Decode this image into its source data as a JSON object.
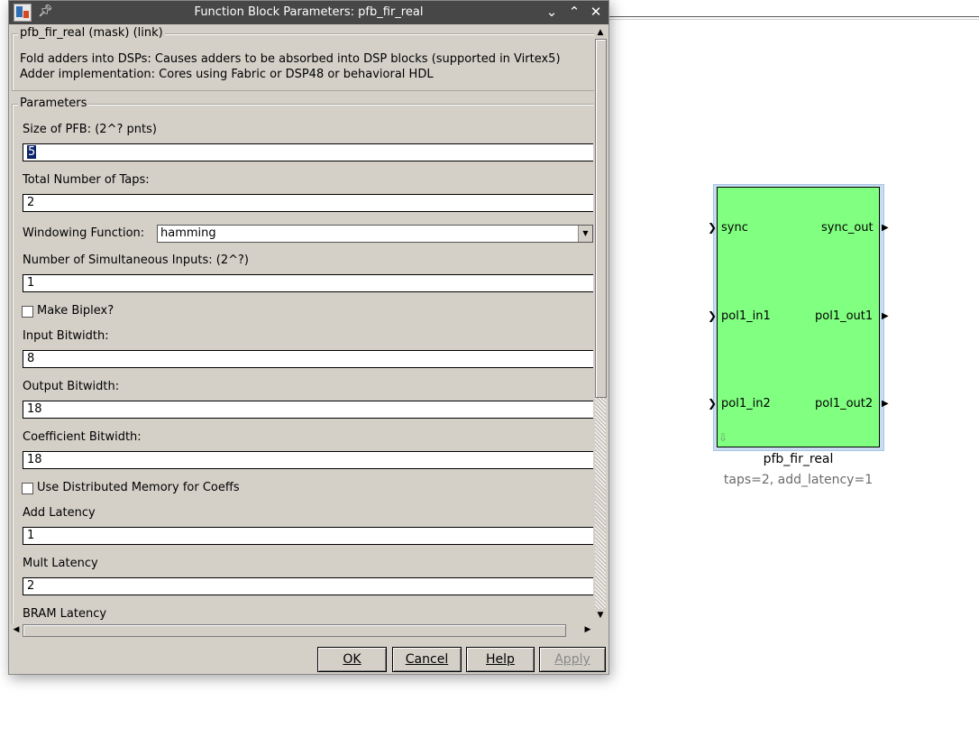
{
  "window": {
    "title": "Function Block Parameters: pfb_fir_real",
    "pin_icon": "pin-icon",
    "minimize_icon": "chevron-down-icon",
    "maximize_icon": "chevron-up-icon",
    "close_icon": "close-icon"
  },
  "mask": {
    "header": "pfb_fir_real (mask) (link)",
    "description_line1": "Fold adders into DSPs: Causes adders to be absorbed into DSP blocks (supported in Virtex5)",
    "description_line2": "Adder implementation: Cores using Fabric or DSP48 or behavioral HDL"
  },
  "params": {
    "legend": "Parameters",
    "size_label": "Size of PFB: (2^? pnts)",
    "size_value": "5",
    "taps_label": "Total Number of Taps:",
    "taps_value": "2",
    "window_label": "Windowing Function:",
    "window_value": "hamming",
    "sim_inputs_label": "Number of Simultaneous Inputs: (2^?)",
    "sim_inputs_value": "1",
    "biplex_label": "Make Biplex?",
    "biplex_checked": false,
    "input_bw_label": "Input Bitwidth:",
    "input_bw_value": "8",
    "output_bw_label": "Output Bitwidth:",
    "output_bw_value": "18",
    "coeff_bw_label": "Coefficient Bitwidth:",
    "coeff_bw_value": "18",
    "dist_mem_label": "Use Distributed Memory for Coeffs",
    "dist_mem_checked": false,
    "add_latency_label": "Add Latency",
    "add_latency_value": "1",
    "mult_latency_label": "Mult Latency",
    "mult_latency_value": "2",
    "bram_latency_label": "BRAM Latency"
  },
  "buttons": {
    "ok": "OK",
    "cancel": "Cancel",
    "help": "Help",
    "apply": "Apply"
  },
  "block": {
    "name": "pfb_fir_real",
    "annotation": "taps=2, add_latency=1",
    "color": "#80ff80",
    "inputs": [
      "sync",
      "pol1_in1",
      "pol1_in2"
    ],
    "outputs": [
      "sync_out",
      "pol1_out1",
      "pol1_out2"
    ]
  }
}
